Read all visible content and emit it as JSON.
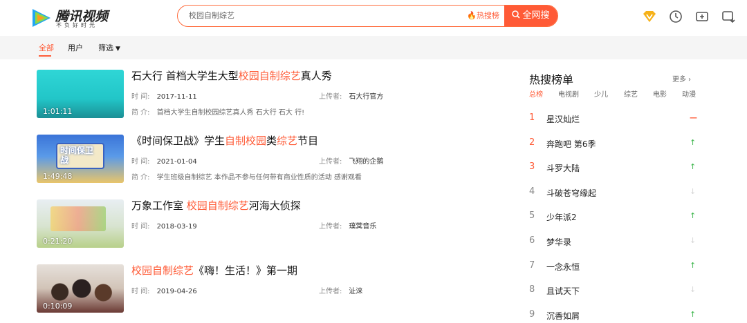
{
  "header": {
    "logo_text": "腾讯视频",
    "logo_slogan": "不负好时光",
    "search": {
      "value": "校园自制综艺",
      "hot_label": "热搜榜",
      "button_label": "全网搜"
    }
  },
  "filters": {
    "tabs": [
      "全部",
      "用户",
      "筛选"
    ],
    "active": "全部"
  },
  "labels": {
    "time": "时 间:",
    "uploader": "上传者:",
    "intro": "简 介:"
  },
  "results": [
    {
      "title_parts": [
        {
          "t": "石大行 首档大学生大型",
          "hl": false
        },
        {
          "t": "校园自制综艺",
          "hl": true
        },
        {
          "t": "真人秀",
          "hl": false
        }
      ],
      "time": "2017-11-11",
      "uploader": "石大行官方",
      "intro": "首档大学生自制校园综艺真人秀 石大行 石大 行!",
      "duration": "1:01:11"
    },
    {
      "title_parts": [
        {
          "t": "《时间保卫战》学生",
          "hl": false
        },
        {
          "t": "自制校园",
          "hl": true
        },
        {
          "t": "类",
          "hl": false
        },
        {
          "t": "综艺",
          "hl": true
        },
        {
          "t": "节目",
          "hl": false
        }
      ],
      "time": "2021-01-04",
      "uploader": "飞翔的企鹅",
      "intro": "学生班级自制综艺 本作品不参与任何带有商业性质的活动 感谢观看",
      "duration": "1:49:48",
      "thumb_text": "时间保卫战"
    },
    {
      "title_parts": [
        {
          "t": "万象工作室 ",
          "hl": false
        },
        {
          "t": "校园自制综艺",
          "hl": true
        },
        {
          "t": "河海大侦探",
          "hl": false
        }
      ],
      "time": "2018-03-19",
      "uploader": "璞蓂音乐",
      "duration": "0:21:20"
    },
    {
      "title_parts": [
        {
          "t": "校园自制综艺",
          "hl": true
        },
        {
          "t": "《嗨！生活！》第一期",
          "hl": false
        }
      ],
      "time": "2019-04-26",
      "uploader": "沚涞",
      "duration": "0:10:09"
    }
  ],
  "hot": {
    "title": "热搜榜单",
    "more": "更多",
    "tabs": [
      "总榜",
      "电视剧",
      "少儿",
      "综艺",
      "电影",
      "动漫"
    ],
    "active_tab": "总榜",
    "items": [
      {
        "rank": "1",
        "name": "星汉灿烂",
        "trend": "flat"
      },
      {
        "rank": "2",
        "name": "奔跑吧 第6季",
        "trend": "up"
      },
      {
        "rank": "3",
        "name": "斗罗大陆",
        "trend": "up"
      },
      {
        "rank": "4",
        "name": "斗破苍穹缘起",
        "trend": "down"
      },
      {
        "rank": "5",
        "name": "少年派2",
        "trend": "up"
      },
      {
        "rank": "6",
        "name": "梦华录",
        "trend": "down"
      },
      {
        "rank": "7",
        "name": "一念永恒",
        "trend": "up"
      },
      {
        "rank": "8",
        "name": "且试天下",
        "trend": "down"
      },
      {
        "rank": "9",
        "name": "沉香如屑",
        "trend": "up"
      }
    ]
  },
  "colors": {
    "accent": "#ff5c38",
    "up": "#3bb54a",
    "down": "#d6d6d6"
  },
  "icons": [
    "vip-diamond-icon",
    "history-clock-icon",
    "upload-icon",
    "download-icon"
  ]
}
